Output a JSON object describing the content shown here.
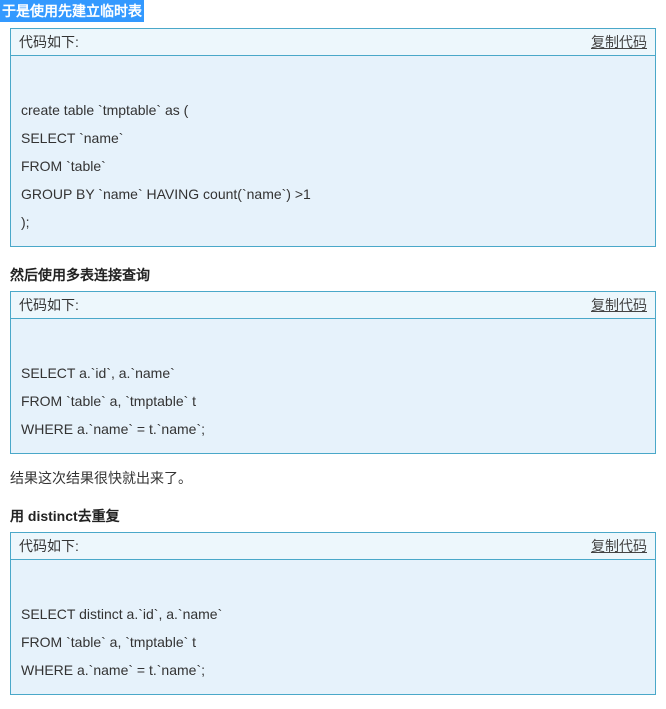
{
  "top_highlight": "于是使用先建立临时表",
  "blocks": [
    {
      "header_label": "代码如下:",
      "copy_label": "复制代码",
      "code": "\ncreate table `tmptable` as (\nSELECT `name`\nFROM `table`\nGROUP BY `name` HAVING count(`name`) >1\n);"
    },
    {
      "header_label": "代码如下:",
      "copy_label": "复制代码",
      "code": "\nSELECT a.`id`, a.`name`\nFROM `table` a, `tmptable` t\nWHERE a.`name` = t.`name`;"
    },
    {
      "header_label": "代码如下:",
      "copy_label": "复制代码",
      "code": "\nSELECT distinct a.`id`, a.`name`\nFROM `table` a, `tmptable` t\nWHERE a.`name` = t.`name`;"
    }
  ],
  "section_text_1": "然后使用多表连接查询",
  "result_text": "结果这次结果很快就出来了。",
  "section_heading_2": "用 distinct去重复"
}
